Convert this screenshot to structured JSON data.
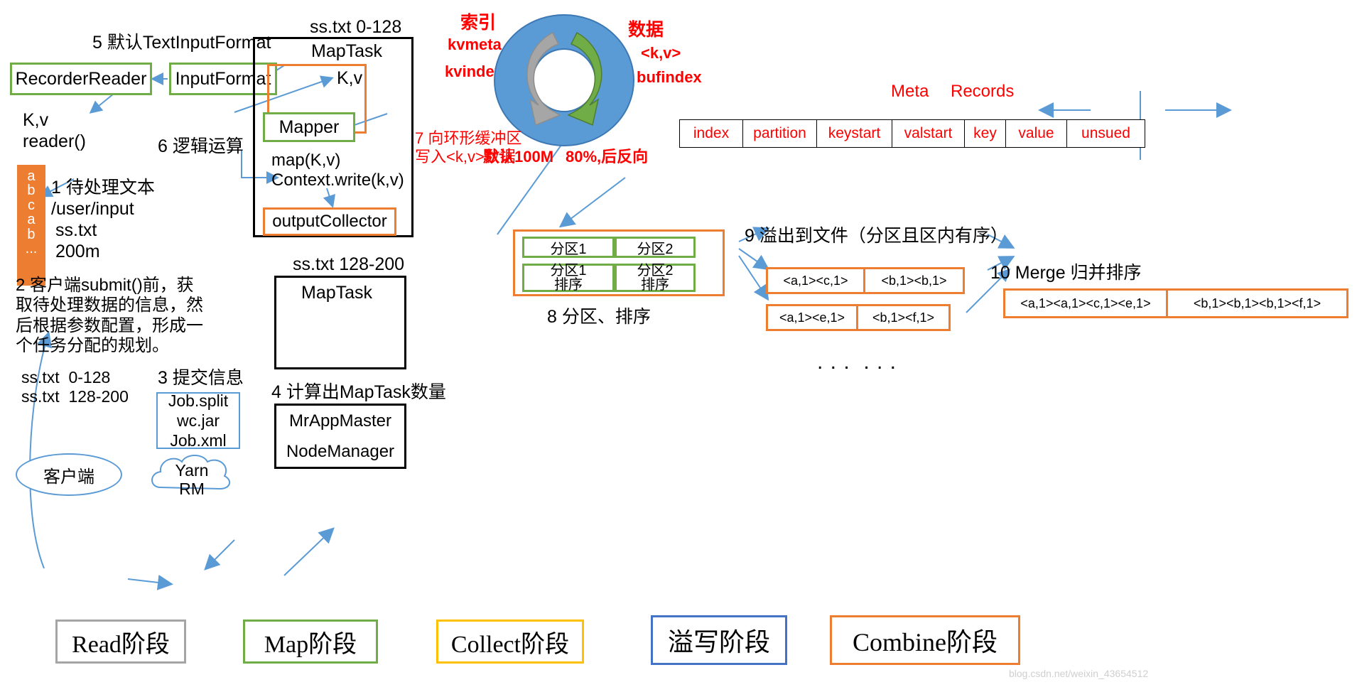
{
  "labels": {
    "step5": "5 默认TextInputFormat",
    "recorder_reader": "RecorderReader",
    "input_format": "InputFormat",
    "kv_reader": "K,v\nreader()",
    "step6": "6 逻辑运算",
    "step1": "1 待处理文本\n/user/input",
    "sstxt_200m": "ss.txt\n200m",
    "step2": "2 客户端submit()前，获\n取待处理数据的信息，然\n后根据参数配置，形成一\n个任务分配的规划。",
    "splits": "ss.txt  0-128\nss.txt  128-200",
    "step3": "3 提交信息",
    "step4": "4 计算出MapTask数量",
    "job_split_box": "Job.split\nwc.jar\nJob.xml",
    "mrappmaster": "MrAppMaster",
    "nodemanager": "NodeManager",
    "client": "客户端",
    "yarn_rm": "Yarn\nRM",
    "maptask_title_1": "ss.txt 0-128",
    "maptask_title_2": "ss.txt 128-200",
    "maptask": "MapTask",
    "kv": "K,v",
    "mapper": "Mapper",
    "map_write": "map(K,v)\nContext.write(k,v)",
    "output_collector": "outputCollector",
    "index": "索引",
    "kvmeta": "kvmeta",
    "kvindex": "kvindex",
    "data": "数据",
    "kv_angle": "<k,v>",
    "bufindex": "bufindex",
    "step7": "7 向环形缓冲区\n写入<k,v>数据",
    "default100m": "默认100M",
    "eighty_percent": "80%,后反向",
    "meta": "Meta",
    "records": "Records",
    "step8": "8 分区、排序",
    "partition1": "分区1",
    "partition2": "分区2",
    "partition1_sorted": "分区1\n排序",
    "partition2_sorted": "分区2\n排序",
    "step9": "9 溢出到文件（分区且区内有序）",
    "step10": "10 Merge 归并排序",
    "ellipsis": ". . .  . . .",
    "orange_bar_chars": "a\nb\nc\na\nb\n..."
  },
  "meta_table": {
    "cells": [
      "index",
      "partition",
      "keystart",
      "valstart",
      "key",
      "value",
      "unsued"
    ]
  },
  "spill_files": {
    "row1": [
      "<a,1><c,1>",
      "<b,1><b,1>"
    ],
    "row2": [
      "<a,1><e,1>",
      "<b,1><f,1>"
    ]
  },
  "merge_files": [
    "<a,1><a,1><c,1><e,1>",
    "<b,1><b,1><b,1><f,1>"
  ],
  "stages": [
    {
      "name": "Read阶段",
      "color": "#a5a5a5"
    },
    {
      "name": "Map阶段",
      "color": "#70ad47"
    },
    {
      "name": "Collect阶段",
      "color": "#ffc000"
    },
    {
      "name": "溢写阶段",
      "color": "#4472c4"
    },
    {
      "name": "Combine阶段",
      "color": "#ed7d31"
    }
  ],
  "colors": {
    "green": "#70ad47",
    "orange": "#ed7d31",
    "blue": "#5b9bd5",
    "red": "#ff0000",
    "gray": "#a5a5a5",
    "yellow": "#ffc000",
    "darkblue": "#4472c4",
    "ring_blue": "#5b9bd5",
    "ring_gray": "#a6a6a6",
    "ring_green": "#70ad47"
  },
  "watermark": "blog.csdn.net/weixin_43654512"
}
